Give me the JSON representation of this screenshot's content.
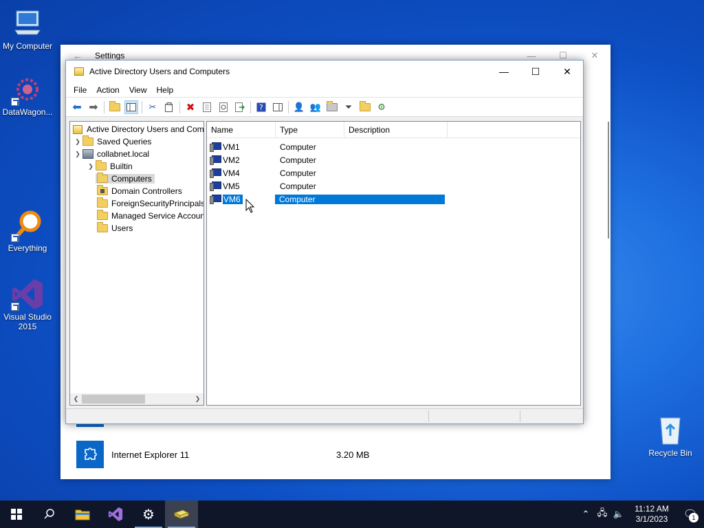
{
  "desktop": {
    "icons": [
      {
        "label": "My Computer"
      },
      {
        "label": "DataWagon..."
      },
      {
        "label": "Everything"
      },
      {
        "label": "Visual Studio 2015"
      },
      {
        "label": "Recycle Bin"
      }
    ]
  },
  "settings": {
    "title": "Settings",
    "app": {
      "name": "Internet Explorer 11",
      "size": "3.20 MB"
    }
  },
  "aduc": {
    "title": "Active Directory Users and Computers",
    "menu": [
      "File",
      "Action",
      "View",
      "Help"
    ],
    "tree": {
      "root": "Active Directory Users and Com",
      "saved_queries": "Saved Queries",
      "domain": "collabnet.local",
      "children": [
        "Builtin",
        "Computers",
        "Domain Controllers",
        "ForeignSecurityPrincipals",
        "Managed Service Accounts",
        "Users"
      ]
    },
    "list": {
      "columns": [
        "Name",
        "Type",
        "Description"
      ],
      "rows": [
        {
          "name": "VM1",
          "type": "Computer"
        },
        {
          "name": "VM2",
          "type": "Computer"
        },
        {
          "name": "VM4",
          "type": "Computer"
        },
        {
          "name": "VM5",
          "type": "Computer"
        },
        {
          "name": "VM6",
          "type": "Computer"
        }
      ],
      "selected": "VM6"
    }
  },
  "taskbar": {
    "time": "11:12 AM",
    "date": "3/1/2023",
    "notifications": "1"
  },
  "colors": {
    "selection": "#0078d7",
    "taskbar": "#10162a",
    "desktop": "#1e6fe0"
  }
}
